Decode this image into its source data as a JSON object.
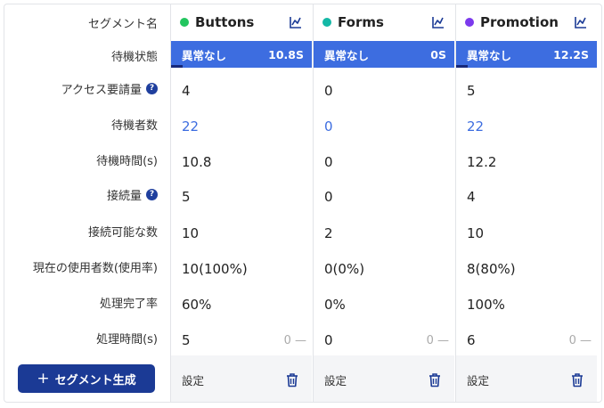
{
  "labels": {
    "segment_name": "セグメント名",
    "wait_status": "待機状態",
    "access_requests": "アクセス要請量",
    "waiting_count": "待機者数",
    "wait_time": "待機時間(s)",
    "connections": "接続量",
    "connectable": "接続可能な数",
    "current_usage": "現在の使用者数(使用率)",
    "completion_rate": "処理完了率",
    "processing_time": "処理時間(s)"
  },
  "create_button_label": "セグメント生成",
  "colors": {
    "status_bar": "#3d6de0",
    "primary_button": "#1b3a95",
    "link": "#3d6de0"
  },
  "segments": [
    {
      "name": "Buttons",
      "dot_color": "#22c55e",
      "status": "異常なし",
      "status_time": "10.8S",
      "status_progress": 0.08,
      "access_requests": "4",
      "waiting_count": "22",
      "wait_time": "10.8",
      "connections": "5",
      "connectable": "10",
      "current_usage": "10(100%)",
      "completion_rate": "60%",
      "processing_time": "5",
      "processing_trend": "0 —",
      "settings_label": "設定"
    },
    {
      "name": "Forms",
      "dot_color": "#14b8a6",
      "status": "異常なし",
      "status_time": "0S",
      "status_progress": 0,
      "access_requests": "0",
      "waiting_count": "0",
      "wait_time": "0",
      "connections": "0",
      "connectable": "2",
      "current_usage": "0(0%)",
      "completion_rate": "0%",
      "processing_time": "0",
      "processing_trend": "0 —",
      "settings_label": "設定"
    },
    {
      "name": "Promotion",
      "dot_color": "#7c3aed",
      "status": "異常なし",
      "status_time": "12.2S",
      "status_progress": 0.08,
      "access_requests": "5",
      "waiting_count": "22",
      "wait_time": "12.2",
      "connections": "4",
      "connectable": "10",
      "current_usage": "8(80%)",
      "completion_rate": "100%",
      "processing_time": "6",
      "processing_trend": "0 —",
      "settings_label": "設定"
    }
  ]
}
